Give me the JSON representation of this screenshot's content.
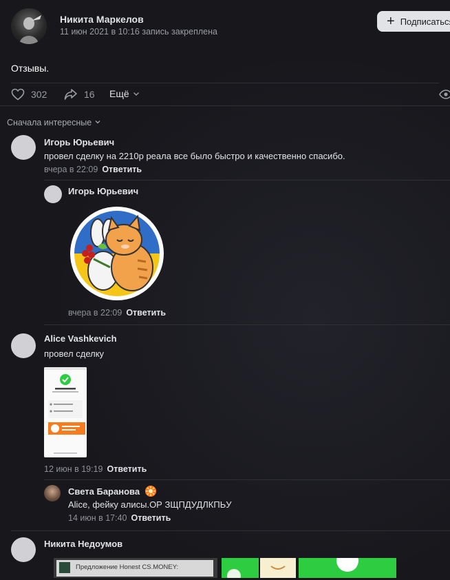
{
  "post": {
    "author": "Никита Маркелов",
    "date": "11 июн 2021 в 10:16",
    "pinned": "запись закреплена",
    "subscribe_label": "Подписаться",
    "text": "Отзывы.",
    "likes": "302",
    "shares": "16",
    "more_label": "Ещё"
  },
  "sort_label": "Сначала интересные",
  "comments": [
    {
      "author": "Игорь Юрьевич",
      "text": "провел сделку на 2210р реала все было быстро и качественно спасибо.",
      "time": "вчера в 22:09",
      "reply_label": "Ответить",
      "replies": [
        {
          "author": "Игорь Юрьевич",
          "time": "вчера в 22:09",
          "reply_label": "Ответить",
          "sticker": "cat-hugging-bunny-sticker"
        }
      ]
    },
    {
      "author": "Alice Vashkevich",
      "text": "провел сделку",
      "time": "12 июн в 19:19",
      "reply_label": "Ответить",
      "replies": [
        {
          "author": "Света Баранова",
          "text": "Alice, фейку алисы.ОР ЗЩПДУДЛКПЬУ",
          "time": "14 июн в 17:40",
          "reply_label": "Ответить"
        }
      ]
    },
    {
      "author": "Никита Недоумов",
      "media_caption": "Предложение Honest CS.MONEY:"
    }
  ],
  "colors": {
    "background": "#17171c",
    "text": "#e1e3e6",
    "muted": "#9a9da3",
    "divider": "#2f2f35",
    "button_bg": "#e1e3e6",
    "success_green": "#2ecc40"
  }
}
